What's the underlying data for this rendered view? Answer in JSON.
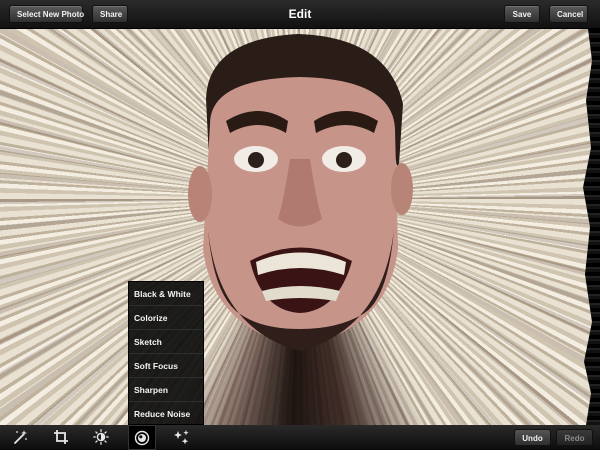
{
  "header": {
    "title": "Edit",
    "select_new_photo": "Select New Photo",
    "share": "Share",
    "save": "Save",
    "cancel": "Cancel"
  },
  "filter_menu": {
    "items": [
      {
        "label": "Black & White"
      },
      {
        "label": "Colorize"
      },
      {
        "label": "Sketch"
      },
      {
        "label": "Soft Focus"
      },
      {
        "label": "Sharpen"
      },
      {
        "label": "Reduce Noise"
      }
    ]
  },
  "toolbar": {
    "tools": [
      {
        "icon": "magic-wand-icon"
      },
      {
        "icon": "crop-icon"
      },
      {
        "icon": "brightness-icon"
      },
      {
        "icon": "filter-icon",
        "active": true
      },
      {
        "icon": "effects-icon"
      }
    ],
    "undo": "Undo",
    "redo": "Redo"
  },
  "colors": {
    "bar_background": "#1a1a1a",
    "button_text": "#f2f2f2",
    "disabled_text": "#8a8a8a"
  }
}
